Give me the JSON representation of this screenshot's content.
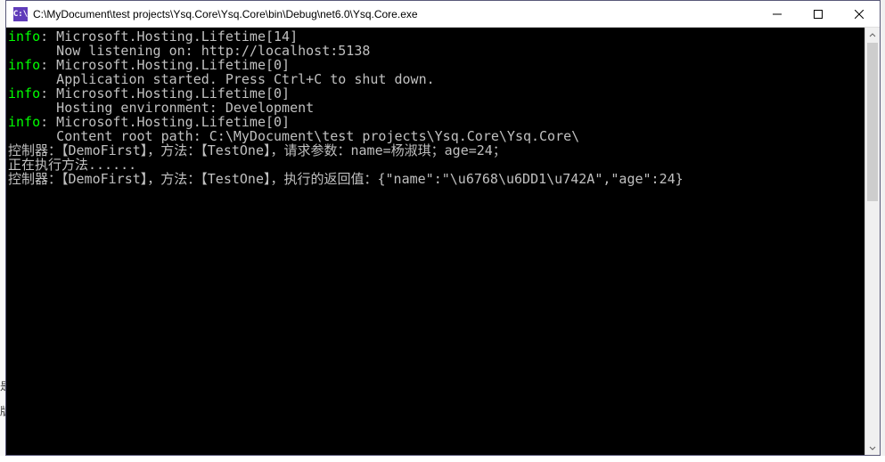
{
  "window": {
    "icon_text": "C:\\",
    "title": " C:\\MyDocument\\test projects\\Ysq.Core\\Ysq.Core\\bin\\Debug\\net6.0\\Ysq.Core.exe"
  },
  "console": {
    "lines": [
      {
        "prefix": "info",
        "text": ": Microsoft.Hosting.Lifetime[14]"
      },
      {
        "prefix": "",
        "text": "      Now listening on: http://localhost:5138"
      },
      {
        "prefix": "info",
        "text": ": Microsoft.Hosting.Lifetime[0]"
      },
      {
        "prefix": "",
        "text": "      Application started. Press Ctrl+C to shut down."
      },
      {
        "prefix": "info",
        "text": ": Microsoft.Hosting.Lifetime[0]"
      },
      {
        "prefix": "",
        "text": "      Hosting environment: Development"
      },
      {
        "prefix": "info",
        "text": ": Microsoft.Hosting.Lifetime[0]"
      },
      {
        "prefix": "",
        "text": "      Content root path: C:\\MyDocument\\test projects\\Ysq.Core\\Ysq.Core\\"
      },
      {
        "prefix": "",
        "text": "控制器：【DemoFirst】，方法：【TestOne】，请求参数：name=杨淑琪；age=24；"
      },
      {
        "prefix": "",
        "text": "正在执行方法......"
      },
      {
        "prefix": "",
        "text": "控制器：【DemoFirst】，方法：【TestOne】，执行的返回值：{\"name\":\"\\u6768\\u6DD1\\u742A\",\"age\":24}"
      }
    ]
  },
  "edge": {
    "left1": "是",
    "left2": "版"
  }
}
